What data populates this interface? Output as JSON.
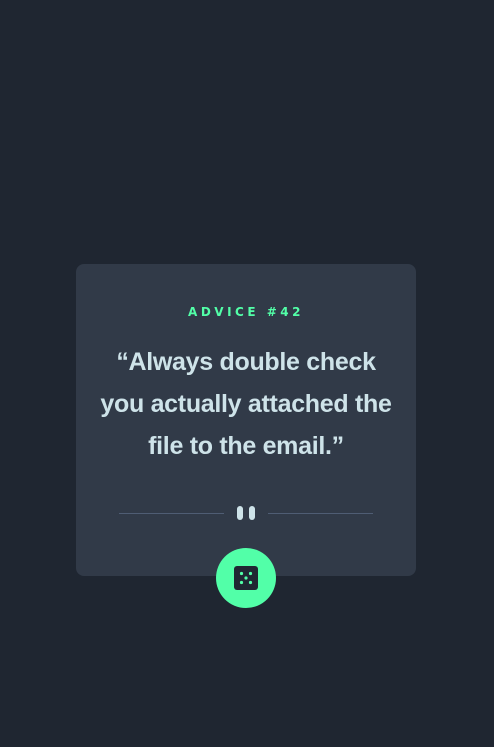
{
  "advice": {
    "label": "ADVICE #42",
    "quote": "“Always double check you actually attached the file to the email.”"
  },
  "divider": {
    "icon": "pause-icon"
  },
  "dice_button": {
    "icon": "dice-icon"
  },
  "colors": {
    "background": "#1f2631",
    "card": "#313a48",
    "accent": "#52ffa8",
    "text": "#cee3e9",
    "divider": "#4f5d74"
  }
}
